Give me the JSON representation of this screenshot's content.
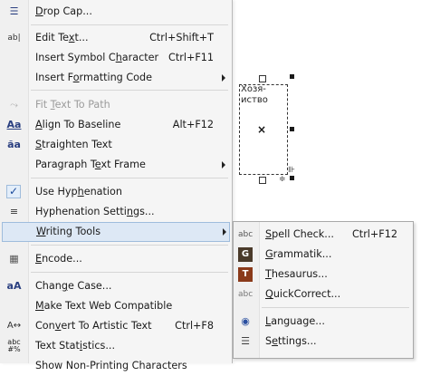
{
  "canvas": {
    "frame_text": "Хозя-\nиство"
  },
  "menu": {
    "items": [
      {
        "label_pre": "",
        "label_u": "D",
        "label_post": "rop Cap...",
        "shortcut": "",
        "icon": "drop-cap-icon",
        "glyph": "A̲",
        "submenu": false
      },
      {
        "label_pre": "Edit Te",
        "label_u": "x",
        "label_post": "t...",
        "shortcut": "Ctrl+Shift+T",
        "icon": "edit-text-icon",
        "glyph": "ab|",
        "submenu": false
      },
      {
        "label_pre": "Insert Symbol C",
        "label_u": "h",
        "label_post": "aracter",
        "shortcut": "Ctrl+F11",
        "icon": "",
        "glyph": "",
        "submenu": false
      },
      {
        "label_pre": "Insert F",
        "label_u": "o",
        "label_post": "rmatting Code",
        "shortcut": "",
        "icon": "",
        "glyph": "",
        "submenu": true
      },
      {
        "label_pre": "Fit ",
        "label_u": "T",
        "label_post": "ext To Path",
        "shortcut": "",
        "icon": "fit-text-to-path-icon",
        "glyph": "⤳",
        "submenu": false,
        "disabled": true
      },
      {
        "label_pre": "",
        "label_u": "A",
        "label_post": "lign To Baseline",
        "shortcut": "Alt+F12",
        "icon": "align-baseline-icon",
        "glyph": "Aa",
        "submenu": false
      },
      {
        "label_pre": "",
        "label_u": "S",
        "label_post": "traighten Text",
        "shortcut": "",
        "icon": "straighten-text-icon",
        "glyph": "ăa",
        "submenu": false
      },
      {
        "label_pre": "Paragraph T",
        "label_u": "e",
        "label_post": "xt Frame",
        "shortcut": "",
        "icon": "",
        "glyph": "",
        "submenu": true
      },
      {
        "label_pre": "Use Hyp",
        "label_u": "h",
        "label_post": "enation",
        "shortcut": "",
        "icon": "check-icon",
        "glyph": "✓",
        "submenu": false,
        "checked": true
      },
      {
        "label_pre": "Hyphenation Setti",
        "label_u": "n",
        "label_post": "gs...",
        "shortcut": "",
        "icon": "hyphenation-settings-icon",
        "glyph": "≡",
        "submenu": false
      },
      {
        "label_pre": "",
        "label_u": "W",
        "label_post": "riting Tools",
        "shortcut": "",
        "icon": "",
        "glyph": "",
        "submenu": true,
        "highlighted": true
      },
      {
        "label_pre": "",
        "label_u": "E",
        "label_post": "ncode...",
        "shortcut": "",
        "icon": "encode-icon",
        "glyph": "▦",
        "submenu": false
      },
      {
        "label_pre": "Chan",
        "label_u": "g",
        "label_post": "e Case...",
        "shortcut": "",
        "icon": "change-case-icon",
        "glyph": "aA",
        "submenu": false
      },
      {
        "label_pre": "",
        "label_u": "M",
        "label_post": "ake Text Web Compatible",
        "shortcut": "",
        "icon": "",
        "glyph": "",
        "submenu": false
      },
      {
        "label_pre": "Con",
        "label_u": "v",
        "label_post": "ert To Artistic Text",
        "shortcut": "Ctrl+F8",
        "icon": "convert-artistic-icon",
        "glyph": "A↔",
        "submenu": false
      },
      {
        "label_pre": "Text Stat",
        "label_u": "i",
        "label_post": "stics...",
        "shortcut": "",
        "icon": "text-statistics-icon",
        "glyph": "abc",
        "submenu": false
      },
      {
        "label_pre": "Show Non-Printing Characters",
        "label_u": "",
        "label_post": "",
        "shortcut": "",
        "icon": "",
        "glyph": "",
        "submenu": false
      }
    ]
  },
  "submenu": {
    "items": [
      {
        "label_pre": "",
        "label_u": "S",
        "label_post": "pell Check...",
        "shortcut": "Ctrl+F12",
        "icon": "spell-check-icon",
        "glyph": "abc"
      },
      {
        "label_pre": "",
        "label_u": "G",
        "label_post": "rammatik...",
        "shortcut": "",
        "icon": "grammatik-icon",
        "glyph": "G"
      },
      {
        "label_pre": "",
        "label_u": "T",
        "label_post": "hesaurus...",
        "shortcut": "",
        "icon": "thesaurus-icon",
        "glyph": "T"
      },
      {
        "label_pre": "",
        "label_u": "Q",
        "label_post": "uickCorrect...",
        "shortcut": "",
        "icon": "quickcorrect-icon",
        "glyph": "abc"
      },
      {
        "label_pre": "",
        "label_u": "L",
        "label_post": "anguage...",
        "shortcut": "",
        "icon": "language-icon",
        "glyph": "◉"
      },
      {
        "label_pre": "S",
        "label_u": "e",
        "label_post": "ttings...",
        "shortcut": "",
        "icon": "settings-icon",
        "glyph": "☰"
      }
    ]
  }
}
